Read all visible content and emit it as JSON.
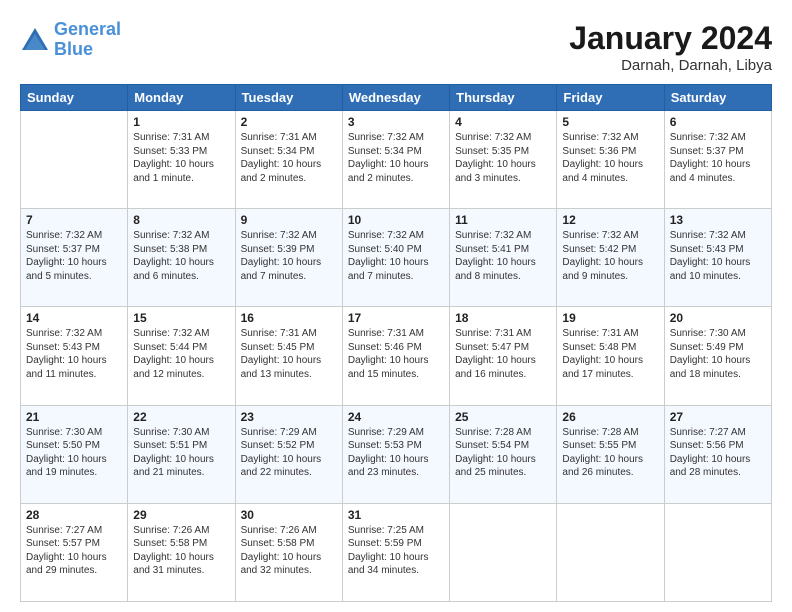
{
  "app": {
    "logo_line1": "General",
    "logo_line2": "Blue",
    "title": "January 2024",
    "subtitle": "Darnah, Darnah, Libya"
  },
  "calendar": {
    "headers": [
      "Sunday",
      "Monday",
      "Tuesday",
      "Wednesday",
      "Thursday",
      "Friday",
      "Saturday"
    ],
    "weeks": [
      [
        {
          "day": "",
          "info": ""
        },
        {
          "day": "1",
          "info": "Sunrise: 7:31 AM\nSunset: 5:33 PM\nDaylight: 10 hours\nand 1 minute."
        },
        {
          "day": "2",
          "info": "Sunrise: 7:31 AM\nSunset: 5:34 PM\nDaylight: 10 hours\nand 2 minutes."
        },
        {
          "day": "3",
          "info": "Sunrise: 7:32 AM\nSunset: 5:34 PM\nDaylight: 10 hours\nand 2 minutes."
        },
        {
          "day": "4",
          "info": "Sunrise: 7:32 AM\nSunset: 5:35 PM\nDaylight: 10 hours\nand 3 minutes."
        },
        {
          "day": "5",
          "info": "Sunrise: 7:32 AM\nSunset: 5:36 PM\nDaylight: 10 hours\nand 4 minutes."
        },
        {
          "day": "6",
          "info": "Sunrise: 7:32 AM\nSunset: 5:37 PM\nDaylight: 10 hours\nand 4 minutes."
        }
      ],
      [
        {
          "day": "7",
          "info": "Sunrise: 7:32 AM\nSunset: 5:37 PM\nDaylight: 10 hours\nand 5 minutes."
        },
        {
          "day": "8",
          "info": "Sunrise: 7:32 AM\nSunset: 5:38 PM\nDaylight: 10 hours\nand 6 minutes."
        },
        {
          "day": "9",
          "info": "Sunrise: 7:32 AM\nSunset: 5:39 PM\nDaylight: 10 hours\nand 7 minutes."
        },
        {
          "day": "10",
          "info": "Sunrise: 7:32 AM\nSunset: 5:40 PM\nDaylight: 10 hours\nand 7 minutes."
        },
        {
          "day": "11",
          "info": "Sunrise: 7:32 AM\nSunset: 5:41 PM\nDaylight: 10 hours\nand 8 minutes."
        },
        {
          "day": "12",
          "info": "Sunrise: 7:32 AM\nSunset: 5:42 PM\nDaylight: 10 hours\nand 9 minutes."
        },
        {
          "day": "13",
          "info": "Sunrise: 7:32 AM\nSunset: 5:43 PM\nDaylight: 10 hours\nand 10 minutes."
        }
      ],
      [
        {
          "day": "14",
          "info": "Sunrise: 7:32 AM\nSunset: 5:43 PM\nDaylight: 10 hours\nand 11 minutes."
        },
        {
          "day": "15",
          "info": "Sunrise: 7:32 AM\nSunset: 5:44 PM\nDaylight: 10 hours\nand 12 minutes."
        },
        {
          "day": "16",
          "info": "Sunrise: 7:31 AM\nSunset: 5:45 PM\nDaylight: 10 hours\nand 13 minutes."
        },
        {
          "day": "17",
          "info": "Sunrise: 7:31 AM\nSunset: 5:46 PM\nDaylight: 10 hours\nand 15 minutes."
        },
        {
          "day": "18",
          "info": "Sunrise: 7:31 AM\nSunset: 5:47 PM\nDaylight: 10 hours\nand 16 minutes."
        },
        {
          "day": "19",
          "info": "Sunrise: 7:31 AM\nSunset: 5:48 PM\nDaylight: 10 hours\nand 17 minutes."
        },
        {
          "day": "20",
          "info": "Sunrise: 7:30 AM\nSunset: 5:49 PM\nDaylight: 10 hours\nand 18 minutes."
        }
      ],
      [
        {
          "day": "21",
          "info": "Sunrise: 7:30 AM\nSunset: 5:50 PM\nDaylight: 10 hours\nand 19 minutes."
        },
        {
          "day": "22",
          "info": "Sunrise: 7:30 AM\nSunset: 5:51 PM\nDaylight: 10 hours\nand 21 minutes."
        },
        {
          "day": "23",
          "info": "Sunrise: 7:29 AM\nSunset: 5:52 PM\nDaylight: 10 hours\nand 22 minutes."
        },
        {
          "day": "24",
          "info": "Sunrise: 7:29 AM\nSunset: 5:53 PM\nDaylight: 10 hours\nand 23 minutes."
        },
        {
          "day": "25",
          "info": "Sunrise: 7:28 AM\nSunset: 5:54 PM\nDaylight: 10 hours\nand 25 minutes."
        },
        {
          "day": "26",
          "info": "Sunrise: 7:28 AM\nSunset: 5:55 PM\nDaylight: 10 hours\nand 26 minutes."
        },
        {
          "day": "27",
          "info": "Sunrise: 7:27 AM\nSunset: 5:56 PM\nDaylight: 10 hours\nand 28 minutes."
        }
      ],
      [
        {
          "day": "28",
          "info": "Sunrise: 7:27 AM\nSunset: 5:57 PM\nDaylight: 10 hours\nand 29 minutes."
        },
        {
          "day": "29",
          "info": "Sunrise: 7:26 AM\nSunset: 5:58 PM\nDaylight: 10 hours\nand 31 minutes."
        },
        {
          "day": "30",
          "info": "Sunrise: 7:26 AM\nSunset: 5:58 PM\nDaylight: 10 hours\nand 32 minutes."
        },
        {
          "day": "31",
          "info": "Sunrise: 7:25 AM\nSunset: 5:59 PM\nDaylight: 10 hours\nand 34 minutes."
        },
        {
          "day": "",
          "info": ""
        },
        {
          "day": "",
          "info": ""
        },
        {
          "day": "",
          "info": ""
        }
      ]
    ]
  }
}
